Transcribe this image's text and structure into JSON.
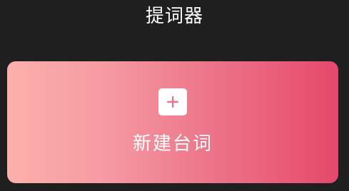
{
  "header": {
    "title": "提词器"
  },
  "create_card": {
    "label": "新建台词",
    "icon": "plus-icon"
  },
  "colors": {
    "background": "#1f1f1f",
    "card_gradient_start": "#fdb0ad",
    "card_gradient_end": "#e5486b",
    "plus_icon": "#e8738a"
  }
}
